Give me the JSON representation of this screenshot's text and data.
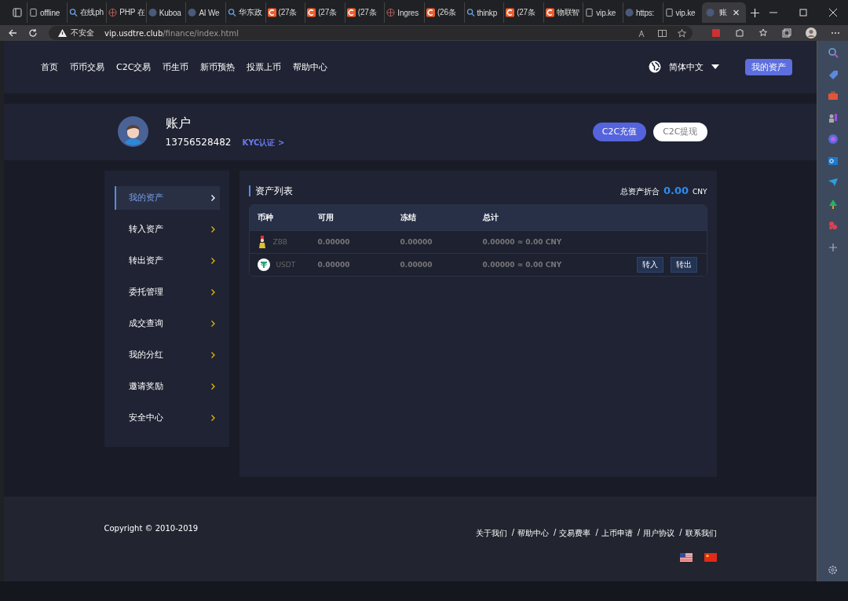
{
  "browser": {
    "tabs": [
      {
        "label": "offline",
        "kind": "doc",
        "selected": false
      },
      {
        "label": "在线ph",
        "kind": "search",
        "selected": false
      },
      {
        "label": "PHP 在",
        "kind": "web",
        "selected": false
      },
      {
        "label": "Kuboa",
        "kind": "circle",
        "selected": false
      },
      {
        "label": "AI We",
        "kind": "circle",
        "selected": false
      },
      {
        "label": "华东政",
        "kind": "search",
        "selected": false
      },
      {
        "label": "(27条",
        "kind": "c",
        "selected": false
      },
      {
        "label": "(27条",
        "kind": "c",
        "selected": false
      },
      {
        "label": "(27条",
        "kind": "c",
        "selected": false
      },
      {
        "label": "Ingres",
        "kind": "web",
        "selected": false
      },
      {
        "label": "(26条",
        "kind": "c",
        "selected": false
      },
      {
        "label": "thinkp",
        "kind": "search",
        "selected": false
      },
      {
        "label": "(27条",
        "kind": "c",
        "selected": false
      },
      {
        "label": "物联智",
        "kind": "c",
        "selected": false
      },
      {
        "label": "vip.ke",
        "kind": "doc",
        "selected": false
      },
      {
        "label": "https:",
        "kind": "circle",
        "selected": false
      },
      {
        "label": "vip.ke",
        "kind": "doc",
        "selected": false
      },
      {
        "label": "账",
        "kind": "circle",
        "selected": true
      }
    ],
    "security": "不安全",
    "url_host": "vip.usdtre.club",
    "url_path": "/finance/index.html"
  },
  "nav": {
    "items": [
      "首页",
      "币币交易",
      "C2C交易",
      "币生币",
      "新币预热",
      "投票上币",
      "帮助中心"
    ],
    "language": "简体中文",
    "assets_button": "我的资产"
  },
  "profile": {
    "title": "账户",
    "phone": "13756528482",
    "kyc_link": "KYC认证 >",
    "buttons": [
      "C2C充值",
      "C2C提现"
    ]
  },
  "sidebar": {
    "items": [
      {
        "label": "我的资产",
        "selected": true
      },
      {
        "label": "转入资产",
        "selected": false
      },
      {
        "label": "转出资产",
        "selected": false
      },
      {
        "label": "委托管理",
        "selected": false
      },
      {
        "label": "成交查询",
        "selected": false
      },
      {
        "label": "我的分红",
        "selected": false
      },
      {
        "label": "邀请奖励",
        "selected": false
      },
      {
        "label": "安全中心",
        "selected": false
      }
    ]
  },
  "assets": {
    "title": "资产列表",
    "total_label": "总资产折合",
    "total_value": "0.00",
    "total_unit": "CNY",
    "table": {
      "columns": [
        "币种",
        "可用",
        "冻结",
        "总计"
      ],
      "rows": [
        {
          "coin": "ZBB",
          "kind": "zbb",
          "available": "0.00000",
          "frozen": "0.00000",
          "total": "0.00000 ≈ 0.00 CNY"
        },
        {
          "coin": "USDT",
          "kind": "usdt",
          "available": "0.00000",
          "frozen": "0.00000",
          "total": "0.00000 ≈ 0.00 CNY",
          "actions": [
            "转入",
            "转出"
          ]
        }
      ]
    }
  },
  "footer": {
    "copyright": "Copyright © 2010-2019",
    "links": [
      {
        "text": "关于我们"
      },
      {
        "separator": "/",
        "text": "帮助中心"
      },
      {
        "separator": "/",
        "text": "交易费率"
      },
      {
        "separator": "/",
        "text": "上币申请"
      },
      {
        "separator": "/",
        "text": "用户协议"
      },
      {
        "separator": "/",
        "text": "联系我们"
      }
    ]
  }
}
